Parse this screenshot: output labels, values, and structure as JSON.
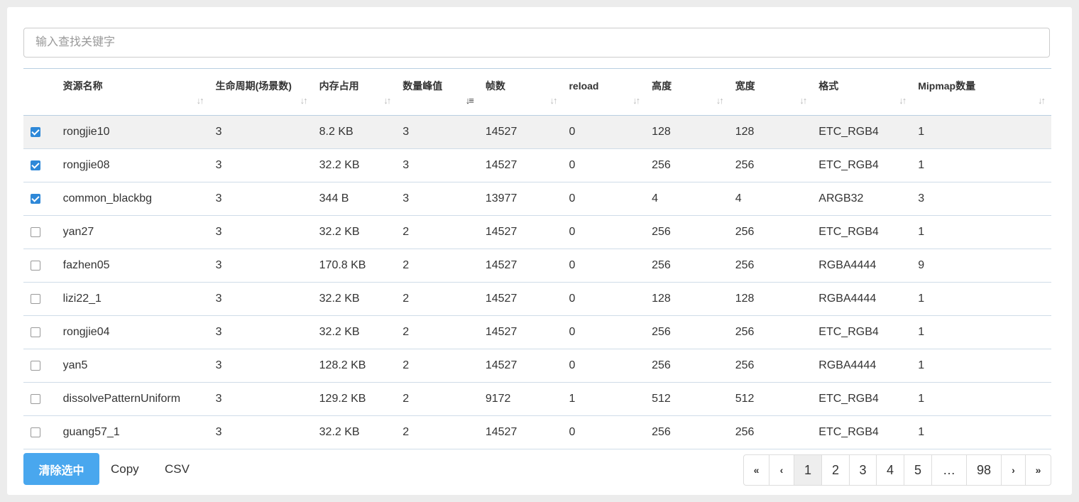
{
  "search": {
    "placeholder": "输入查找关键字",
    "value": ""
  },
  "table": {
    "columns": [
      {
        "label": "资源名称",
        "sort": "none"
      },
      {
        "label": "生命周期(场景数)",
        "sort": "none"
      },
      {
        "label": "内存占用",
        "sort": "none"
      },
      {
        "label": "数量峰值",
        "sort": "desc"
      },
      {
        "label": "帧数",
        "sort": "none"
      },
      {
        "label": "reload",
        "sort": "none"
      },
      {
        "label": "高度",
        "sort": "none"
      },
      {
        "label": "宽度",
        "sort": "none"
      },
      {
        "label": "格式",
        "sort": "none"
      },
      {
        "label": "Mipmap数量",
        "sort": "none"
      }
    ],
    "rows": [
      {
        "checked": true,
        "cells": [
          "rongjie10",
          "3",
          "8.2 KB",
          "3",
          "14527",
          "0",
          "128",
          "128",
          "ETC_RGB4",
          "1"
        ]
      },
      {
        "checked": true,
        "cells": [
          "rongjie08",
          "3",
          "32.2 KB",
          "3",
          "14527",
          "0",
          "256",
          "256",
          "ETC_RGB4",
          "1"
        ]
      },
      {
        "checked": true,
        "cells": [
          "common_blackbg",
          "3",
          "344 B",
          "3",
          "13977",
          "0",
          "4",
          "4",
          "ARGB32",
          "3"
        ]
      },
      {
        "checked": false,
        "cells": [
          "yan27",
          "3",
          "32.2 KB",
          "2",
          "14527",
          "0",
          "256",
          "256",
          "ETC_RGB4",
          "1"
        ]
      },
      {
        "checked": false,
        "cells": [
          "fazhen05",
          "3",
          "170.8 KB",
          "2",
          "14527",
          "0",
          "256",
          "256",
          "RGBA4444",
          "9"
        ]
      },
      {
        "checked": false,
        "cells": [
          "lizi22_1",
          "3",
          "32.2 KB",
          "2",
          "14527",
          "0",
          "128",
          "128",
          "RGBA4444",
          "1"
        ]
      },
      {
        "checked": false,
        "cells": [
          "rongjie04",
          "3",
          "32.2 KB",
          "2",
          "14527",
          "0",
          "256",
          "256",
          "ETC_RGB4",
          "1"
        ]
      },
      {
        "checked": false,
        "cells": [
          "yan5",
          "3",
          "128.2 KB",
          "2",
          "14527",
          "0",
          "256",
          "256",
          "RGBA4444",
          "1"
        ]
      },
      {
        "checked": false,
        "cells": [
          "dissolvePatternUniform",
          "3",
          "129.2 KB",
          "2",
          "9172",
          "1",
          "512",
          "512",
          "ETC_RGB4",
          "1"
        ]
      },
      {
        "checked": false,
        "cells": [
          "guang57_1",
          "3",
          "32.2 KB",
          "2",
          "14527",
          "0",
          "256",
          "256",
          "ETC_RGB4",
          "1"
        ]
      }
    ],
    "hover_row": 0
  },
  "actions": {
    "clear_label": "清除选中",
    "copy_label": "Copy",
    "csv_label": "CSV"
  },
  "pagination": {
    "first": "«",
    "prev": "‹",
    "next": "›",
    "last": "»",
    "pages": [
      "1",
      "2",
      "3",
      "4",
      "5"
    ],
    "ellipsis": "…",
    "last_page": "98",
    "current": "1"
  },
  "colors": {
    "accent": "#49a7ee",
    "checkbox": "#2e88d8",
    "border": "#b9cfe2"
  }
}
